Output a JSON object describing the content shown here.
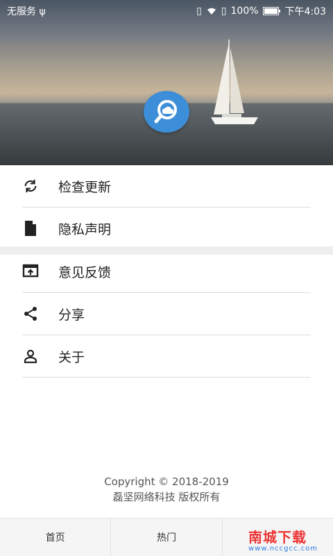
{
  "status_bar": {
    "left_text": "无服务",
    "battery": "100%",
    "time": "下午4:03"
  },
  "header": {
    "logo_icon": "search-cloud-icon",
    "accent_color": "#3d8ed8"
  },
  "menu": {
    "group1": [
      {
        "label": "检查更新",
        "icon": "refresh-icon"
      },
      {
        "label": "隐私声明",
        "icon": "document-icon"
      }
    ],
    "group2": [
      {
        "label": "意见反馈",
        "icon": "feedback-icon"
      },
      {
        "label": "分享",
        "icon": "share-icon"
      },
      {
        "label": "关于",
        "icon": "person-icon"
      }
    ]
  },
  "footer": {
    "copyright": "Copyright © 2018-2019",
    "company": "磊坚网络科技 版权所有"
  },
  "bottom_nav": {
    "tabs": [
      {
        "label": "首页"
      },
      {
        "label": "热门"
      },
      {
        "label": ""
      }
    ]
  },
  "watermark": {
    "title": "南城下载",
    "url": "www.nccgcc.com"
  }
}
